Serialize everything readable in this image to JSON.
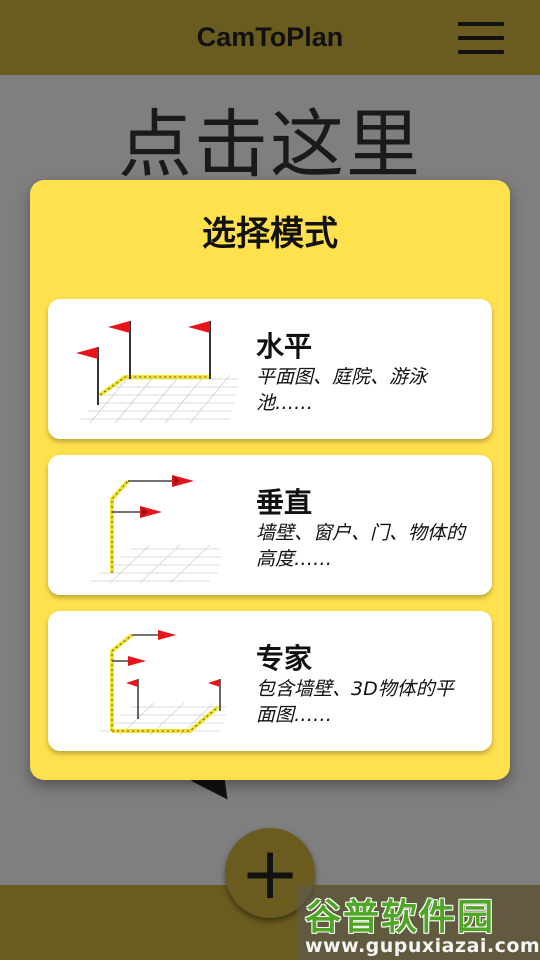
{
  "header": {
    "title": "CamToPlan",
    "menu_icon": "hamburger-menu-icon"
  },
  "background": {
    "hint_text": "点击这里"
  },
  "dialog": {
    "title": "选择模式",
    "modes": [
      {
        "title": "水平",
        "description": "平面图、庭院、游泳池……",
        "icon": "horizontal-mode-icon"
      },
      {
        "title": "垂直",
        "description": "墙壁、窗户、门、物体的高度……",
        "icon": "vertical-mode-icon"
      },
      {
        "title": "专家",
        "description": "包含墙壁、3D物体的平面图……",
        "icon": "expert-mode-icon"
      }
    ]
  },
  "fab": {
    "label": "+",
    "icon": "plus-icon"
  },
  "watermark": {
    "brand": "谷普软件园",
    "url": "www.gupuxiazai.com"
  },
  "colors": {
    "header": "#6a5c1e",
    "dialog": "#ffe04d",
    "card": "#ffffff",
    "overlay": "#7f7f7f",
    "flag": "#e8141c",
    "tape": "#f2e22a"
  }
}
